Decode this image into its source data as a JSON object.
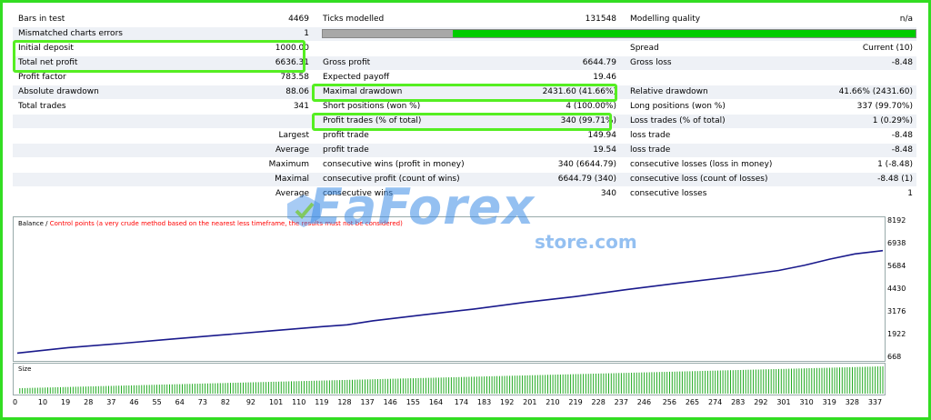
{
  "colors": {
    "frame_border": "#33dd22",
    "highlight": "#55ee22",
    "quality_bar": "#00cc00",
    "quality_bar_empty": "#a8a8a8",
    "balance_line": "#1a1a8c",
    "size_bars": "#22aa22",
    "control_points_text": "#ff0000",
    "watermark": "#3c8ce6"
  },
  "summary": {
    "bars_in_test": {
      "label": "Bars in test",
      "value": "4469"
    },
    "ticks_modelled": {
      "label": "Ticks modelled",
      "value": "131548"
    },
    "modelling_quality": {
      "label": "Modelling quality",
      "value": "n/a"
    },
    "mismatched": {
      "label": "Mismatched charts errors",
      "value": "1"
    },
    "initial_deposit": {
      "label": "Initial deposit",
      "value": "1000.00"
    },
    "spread": {
      "label": "Spread",
      "value": "Current (10)"
    },
    "total_net_profit": {
      "label": "Total net profit",
      "value": "6636.31"
    },
    "gross_profit": {
      "label": "Gross profit",
      "value": "6644.79"
    },
    "gross_loss": {
      "label": "Gross loss",
      "value": "-8.48"
    },
    "profit_factor": {
      "label": "Profit factor",
      "value": "783.58"
    },
    "expected_payoff": {
      "label": "Expected payoff",
      "value": "19.46"
    },
    "absolute_drawdown": {
      "label": "Absolute drawdown",
      "value": "88.06"
    },
    "maximal_drawdown": {
      "label": "Maximal drawdown",
      "value": "2431.60 (41.66%)"
    },
    "relative_drawdown": {
      "label": "Relative drawdown",
      "value": "41.66% (2431.60)"
    },
    "total_trades": {
      "label": "Total trades",
      "value": "341"
    },
    "short_positions": {
      "label": "Short positions (won %)",
      "value": "4 (100.00%)"
    },
    "long_positions": {
      "label": "Long positions (won %)",
      "value": "337 (99.70%)"
    },
    "profit_trades": {
      "label": "Profit trades (% of total)",
      "value": "340 (99.71%)"
    },
    "loss_trades": {
      "label": "Loss trades (% of total)",
      "value": "1 (0.29%)"
    },
    "largest": {
      "label": "Largest",
      "profit_label": "profit trade",
      "profit_value": "149.94",
      "loss_label": "loss trade",
      "loss_value": "-8.48"
    },
    "average": {
      "label": "Average",
      "profit_label": "profit trade",
      "profit_value": "19.54",
      "loss_label": "loss trade",
      "loss_value": "-8.48"
    },
    "maximum": {
      "label": "Maximum",
      "profit_label": "consecutive wins (profit in money)",
      "profit_value": "340 (6644.79)",
      "loss_label": "consecutive losses (loss in money)",
      "loss_value": "1 (-8.48)"
    },
    "maximal": {
      "label": "Maximal",
      "profit_label": "consecutive profit (count of wins)",
      "profit_value": "6644.79 (340)",
      "loss_label": "consecutive loss (count of losses)",
      "loss_value": "-8.48 (1)"
    },
    "average2": {
      "label": "Average",
      "profit_label": "consecutive wins",
      "profit_value": "340",
      "loss_label": "consecutive losses",
      "loss_value": "1"
    }
  },
  "modelling_quality_fraction": 0.22,
  "watermark": {
    "main": "EaForex",
    "sub": "store.com"
  },
  "chart": {
    "balance_label": "Balance",
    "separator": " / ",
    "control_points_note": "Control points (a very crude method based on the nearest less timeframe, the results must not be considered)",
    "size_label": "Size",
    "y_ticks": [
      "8192",
      "6938",
      "5684",
      "4430",
      "3176",
      "1922",
      "668"
    ],
    "x_ticks": [
      "0",
      "10",
      "19",
      "28",
      "37",
      "46",
      "55",
      "64",
      "73",
      "82",
      "92",
      "101",
      "110",
      "119",
      "128",
      "137",
      "146",
      "155",
      "164",
      "174",
      "183",
      "192",
      "201",
      "210",
      "219",
      "228",
      "237",
      "246",
      "256",
      "265",
      "274",
      "283",
      "292",
      "301",
      "310",
      "319",
      "328",
      "337"
    ]
  },
  "chart_data": {
    "type": "line",
    "title": "",
    "xlabel": "",
    "ylabel": "",
    "ylim": [
      668,
      8192
    ],
    "xlim": [
      0,
      341
    ],
    "series": [
      {
        "name": "Balance",
        "x": [
          0,
          20,
          40,
          60,
          80,
          100,
          120,
          130,
          140,
          160,
          180,
          200,
          220,
          240,
          260,
          280,
          300,
          310,
          320,
          330,
          341
        ],
        "values": [
          1000,
          1300,
          1520,
          1760,
          1990,
          2230,
          2460,
          2560,
          2780,
          3110,
          3430,
          3800,
          4120,
          4500,
          4850,
          5180,
          5560,
          5840,
          6180,
          6470,
          6650
        ]
      }
    ],
    "size_bars": {
      "x_from": 1,
      "x_to": 341,
      "start_fraction": 0.2,
      "end_fraction": 1.0
    }
  }
}
